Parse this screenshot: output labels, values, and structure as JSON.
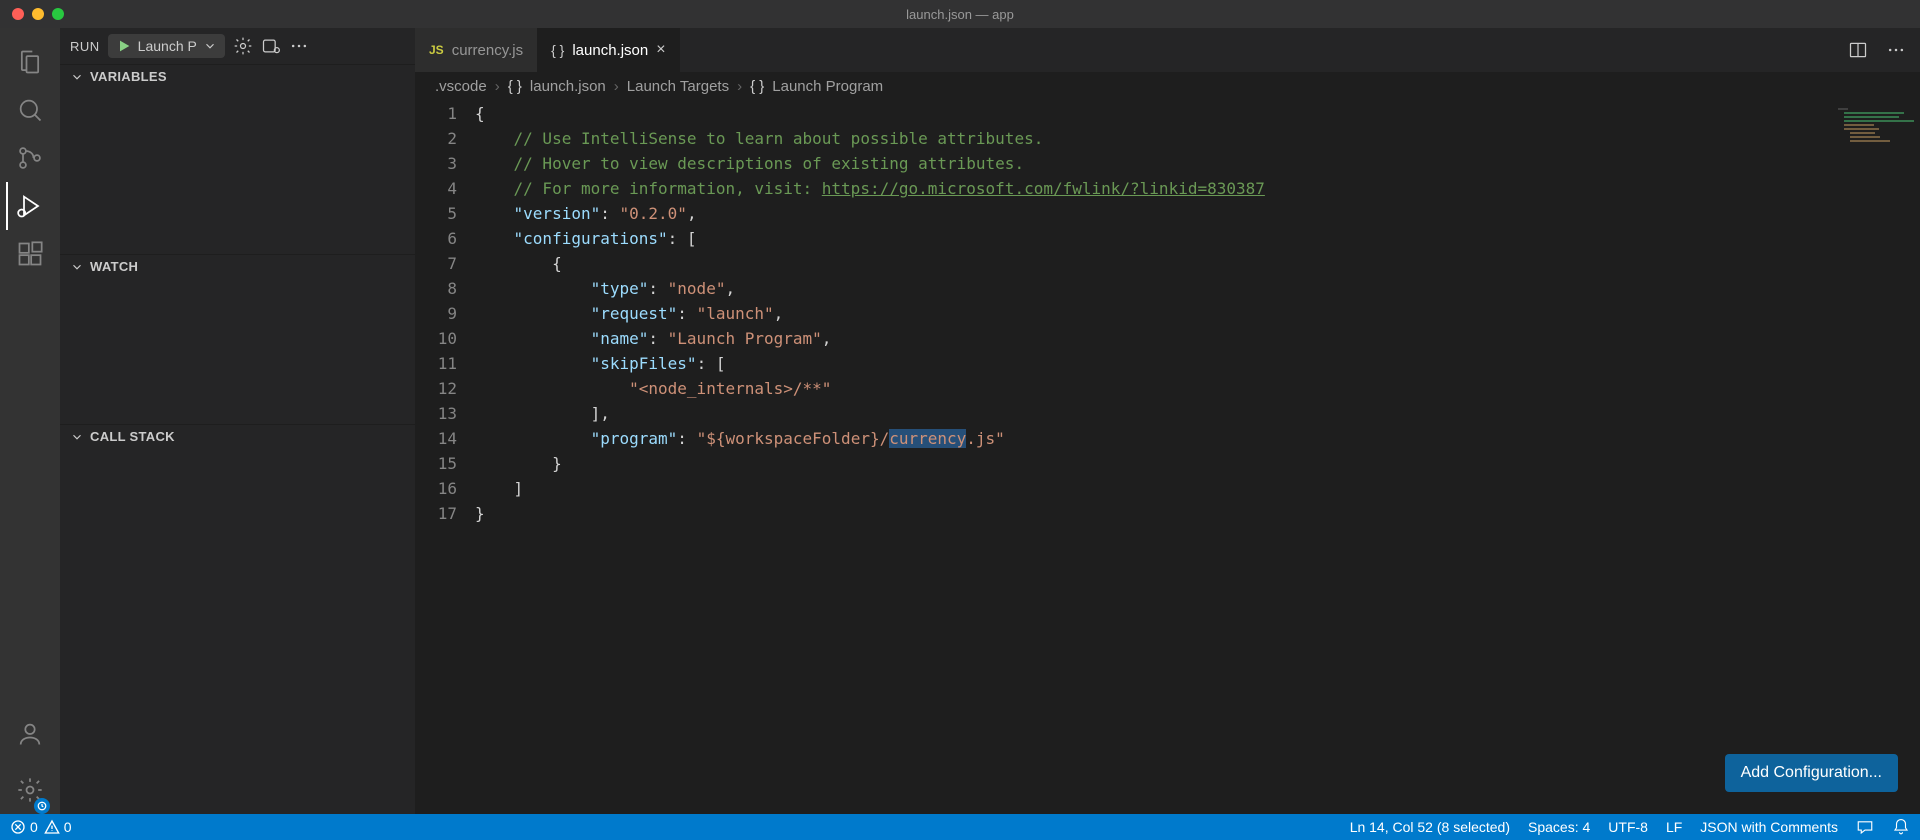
{
  "window": {
    "title": "launch.json — app"
  },
  "sidebar": {
    "run_label": "RUN",
    "launch_config": "Launch P",
    "sections": {
      "variables": "VARIABLES",
      "watch": "WATCH",
      "callstack": "CALL STACK"
    }
  },
  "tabs": [
    {
      "icon": "js-icon",
      "label": "currency.js",
      "active": false
    },
    {
      "icon": "json-icon",
      "label": "launch.json",
      "active": true
    }
  ],
  "breadcrumbs": [
    ".vscode",
    "launch.json",
    "Launch Targets",
    "Launch Program"
  ],
  "editor": {
    "line_numbers": [
      "1",
      "2",
      "3",
      "4",
      "5",
      "6",
      "7",
      "8",
      "9",
      "10",
      "11",
      "12",
      "13",
      "14",
      "15",
      "16",
      "17"
    ],
    "lines": [
      [
        {
          "t": "p",
          "v": "{"
        }
      ],
      [
        {
          "t": "p",
          "v": "    "
        },
        {
          "t": "c",
          "v": "// Use IntelliSense to learn about possible attributes."
        }
      ],
      [
        {
          "t": "p",
          "v": "    "
        },
        {
          "t": "c",
          "v": "// Hover to view descriptions of existing attributes."
        }
      ],
      [
        {
          "t": "p",
          "v": "    "
        },
        {
          "t": "c",
          "v": "// For more information, visit: "
        },
        {
          "t": "l",
          "v": "https://go.microsoft.com/fwlink/?linkid=830387"
        }
      ],
      [
        {
          "t": "p",
          "v": "    "
        },
        {
          "t": "k",
          "v": "\"version\""
        },
        {
          "t": "p",
          "v": ": "
        },
        {
          "t": "s",
          "v": "\"0.2.0\""
        },
        {
          "t": "p",
          "v": ","
        }
      ],
      [
        {
          "t": "p",
          "v": "    "
        },
        {
          "t": "k",
          "v": "\"configurations\""
        },
        {
          "t": "p",
          "v": ": ["
        }
      ],
      [
        {
          "t": "p",
          "v": "        {"
        }
      ],
      [
        {
          "t": "p",
          "v": "            "
        },
        {
          "t": "k",
          "v": "\"type\""
        },
        {
          "t": "p",
          "v": ": "
        },
        {
          "t": "s",
          "v": "\"node\""
        },
        {
          "t": "p",
          "v": ","
        }
      ],
      [
        {
          "t": "p",
          "v": "            "
        },
        {
          "t": "k",
          "v": "\"request\""
        },
        {
          "t": "p",
          "v": ": "
        },
        {
          "t": "s",
          "v": "\"launch\""
        },
        {
          "t": "p",
          "v": ","
        }
      ],
      [
        {
          "t": "p",
          "v": "            "
        },
        {
          "t": "k",
          "v": "\"name\""
        },
        {
          "t": "p",
          "v": ": "
        },
        {
          "t": "s",
          "v": "\"Launch Program\""
        },
        {
          "t": "p",
          "v": ","
        }
      ],
      [
        {
          "t": "p",
          "v": "            "
        },
        {
          "t": "k",
          "v": "\"skipFiles\""
        },
        {
          "t": "p",
          "v": ": ["
        }
      ],
      [
        {
          "t": "p",
          "v": "                "
        },
        {
          "t": "s",
          "v": "\"<node_internals>/**\""
        }
      ],
      [
        {
          "t": "p",
          "v": "            ],"
        }
      ],
      [
        {
          "t": "p",
          "v": "            "
        },
        {
          "t": "k",
          "v": "\"program\""
        },
        {
          "t": "p",
          "v": ": "
        },
        {
          "t": "s",
          "v": "\"${workspaceFolder}/"
        },
        {
          "t": "s sel",
          "v": "currency"
        },
        {
          "t": "s",
          "v": ".js\""
        }
      ],
      [
        {
          "t": "p",
          "v": "        }"
        }
      ],
      [
        {
          "t": "p",
          "v": "    ]"
        }
      ],
      [
        {
          "t": "p",
          "v": "}"
        }
      ]
    ]
  },
  "buttons": {
    "add_configuration": "Add Configuration..."
  },
  "statusbar": {
    "errors": "0",
    "warnings": "0",
    "position": "Ln 14, Col 52 (8 selected)",
    "spaces": "Spaces: 4",
    "encoding": "UTF-8",
    "eol": "LF",
    "language": "JSON with Comments"
  }
}
